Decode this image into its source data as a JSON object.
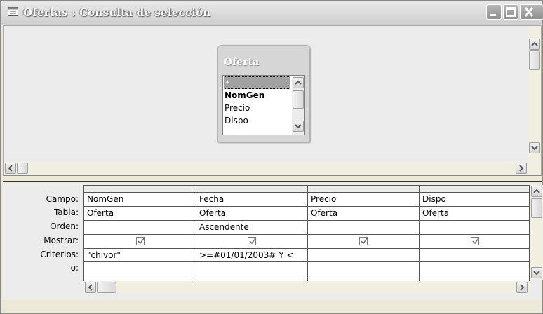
{
  "window": {
    "title": "Ofertas : Consulta de selección"
  },
  "field_list": {
    "table_name": "Oferta",
    "fields": [
      "*",
      "NomGen",
      "Precio",
      "Dispo"
    ]
  },
  "grid": {
    "row_labels": {
      "campo": "Campo:",
      "tabla": "Tabla:",
      "orden": "Orden:",
      "mostrar": "Mostrar:",
      "criterios": "Criterios:",
      "o": "o:"
    },
    "columns": [
      {
        "campo": "NomGen",
        "tabla": "Oferta",
        "orden": "",
        "mostrar": true,
        "criterios": "\"chivor\""
      },
      {
        "campo": "Fecha",
        "tabla": "Oferta",
        "orden": "Ascendente",
        "mostrar": true,
        "criterios": ">=#01/01/2003# Y <"
      },
      {
        "campo": "Precio",
        "tabla": "Oferta",
        "orden": "",
        "mostrar": true,
        "criterios": ""
      },
      {
        "campo": "Dispo",
        "tabla": "Oferta",
        "orden": "",
        "mostrar": true,
        "criterios": ""
      }
    ]
  },
  "icons": {
    "title": "query-window-icon",
    "minimize": "minimize-icon",
    "maximize": "maximize-icon",
    "close": "close-icon"
  }
}
